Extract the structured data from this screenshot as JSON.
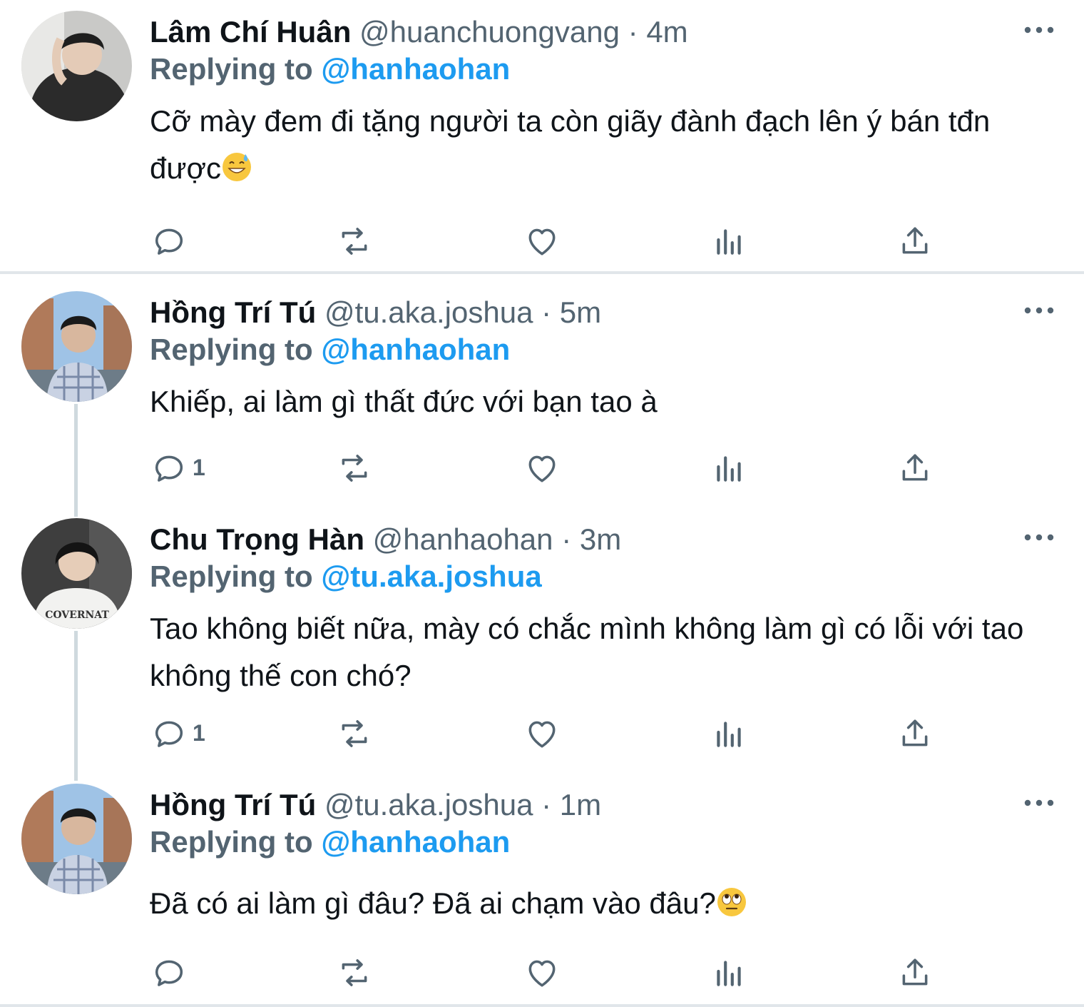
{
  "tweets": [
    {
      "name": "Lâm Chí Huân",
      "handle": "@huanchuongvang",
      "dot": "·",
      "time": "4m",
      "reply_label": "Replying to",
      "reply_to": "@hanhaohan",
      "text": "Cỡ mày đem đi tặng người ta còn giãy đành đạch lên ý bán tđn được",
      "emoji": "grinning-sweat-emoji",
      "reply_count": "",
      "avatar_icon": "avatar-photo"
    },
    {
      "name": "Hồng Trí Tú",
      "handle": "@tu.aka.joshua",
      "dot": "·",
      "time": "5m",
      "reply_label": "Replying to",
      "reply_to": "@hanhaohan",
      "text": "Khiếp, ai làm gì thất đức với bạn tao à",
      "reply_count": "1",
      "avatar_icon": "avatar-photo"
    },
    {
      "name": "Chu Trọng Hàn",
      "handle": "@hanhaohan",
      "dot": "·",
      "time": "3m",
      "reply_label": "Replying to",
      "reply_to": "@tu.aka.joshua",
      "text": "Tao không biết nữa, mày có chắc mình không làm gì có lỗi với tao không thế con chó?",
      "reply_count": "1",
      "avatar_icon": "avatar-photo"
    },
    {
      "name": "Hồng Trí Tú",
      "handle": "@tu.aka.joshua",
      "dot": "·",
      "time": "1m",
      "reply_label": "Replying to",
      "reply_to": "@hanhaohan",
      "text": "Đã có ai làm gì đâu? Đã ai chạm vào đâu?",
      "emoji": "eye-roll-emoji",
      "reply_count": "",
      "avatar_icon": "avatar-photo"
    }
  ],
  "icons": {
    "reply": "reply-icon",
    "retweet": "retweet-icon",
    "like": "heart-icon",
    "analytics": "analytics-icon",
    "share": "share-icon",
    "more": "more-icon"
  },
  "colors": {
    "name": "#0f1419",
    "secondary": "#536471",
    "link": "#1d9bf0",
    "thread_line": "#cfd9de"
  }
}
